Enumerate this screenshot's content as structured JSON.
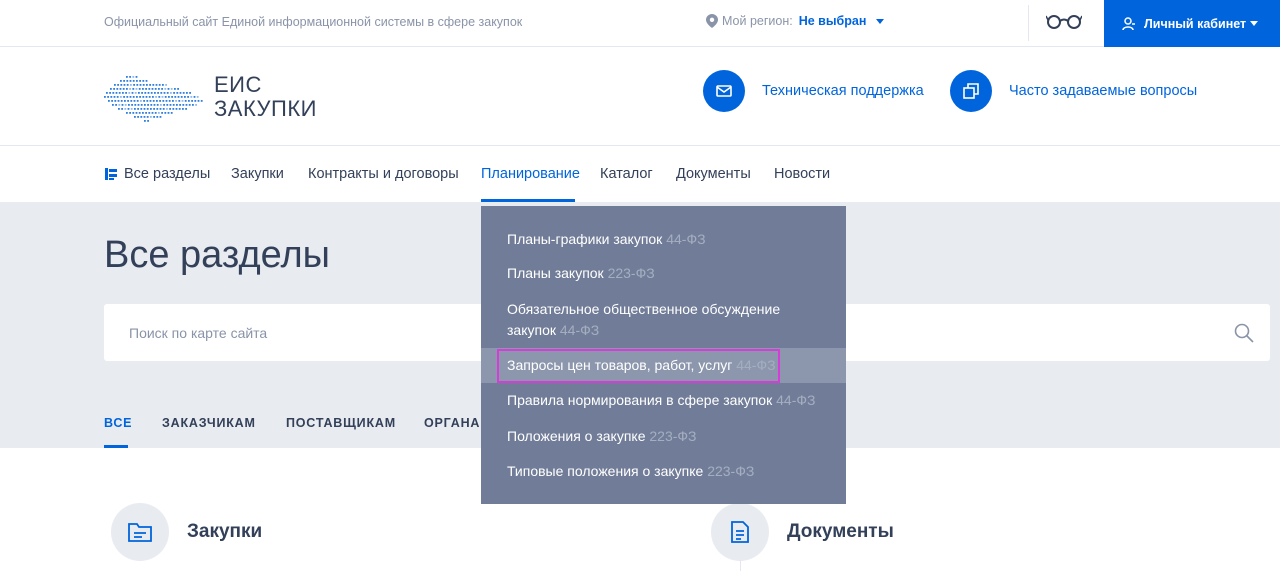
{
  "topbar": {
    "official_text": "Официальный сайт Единой информационной системы в сфере закупок",
    "region_label": "Мой регион:",
    "region_value": "Не выбран",
    "cabinet_label": "Личный кабинет"
  },
  "header": {
    "logo_line1": "ЕИС",
    "logo_line2": "ЗАКУПКИ",
    "support_label": "Техническая поддержка",
    "faq_label": "Часто задаваемые вопросы"
  },
  "nav": {
    "items": [
      {
        "label": "Все разделы"
      },
      {
        "label": "Закупки"
      },
      {
        "label": "Контракты и договоры"
      },
      {
        "label": "Планирование"
      },
      {
        "label": "Каталог"
      },
      {
        "label": "Документы"
      },
      {
        "label": "Новости"
      }
    ],
    "active": "Планирование"
  },
  "hero": {
    "title": "Все разделы",
    "search_placeholder": "Поиск по карте сайта"
  },
  "tabs": [
    {
      "label": "ВСЕ"
    },
    {
      "label": "ЗАКАЗЧИКАМ"
    },
    {
      "label": "ПОСТАВЩИКАМ"
    },
    {
      "label": "ОРГАНАМ"
    }
  ],
  "dropdown": {
    "items": [
      {
        "label": "Планы-графики закупок",
        "law": "44-ФЗ"
      },
      {
        "label": "Планы закупок",
        "law": "223-ФЗ"
      },
      {
        "label": "Обязательное общественное обсуждение",
        "label2": "закупок",
        "law": "44-ФЗ"
      },
      {
        "label": "Запросы цен товаров, работ, услуг",
        "law": "44-ФЗ"
      },
      {
        "label": "Правила нормирования в сфере закупок",
        "law": "44-ФЗ"
      },
      {
        "label": "Положения о закупке",
        "law": "223-ФЗ"
      },
      {
        "label": "Типовые положения о закупке",
        "law": "223-ФЗ"
      }
    ],
    "highlighted_index": 3
  },
  "sections": [
    {
      "title": "Закупки",
      "icon": "folder-icon"
    },
    {
      "title": "Документы",
      "icon": "document-icon"
    }
  ],
  "colors": {
    "accent": "#0065dd",
    "text": "#334059",
    "muted": "#8a94a8",
    "hero_bg": "#e8ebef",
    "dropdown_bg": "#717d98",
    "highlight_border": "#d63dd8"
  }
}
